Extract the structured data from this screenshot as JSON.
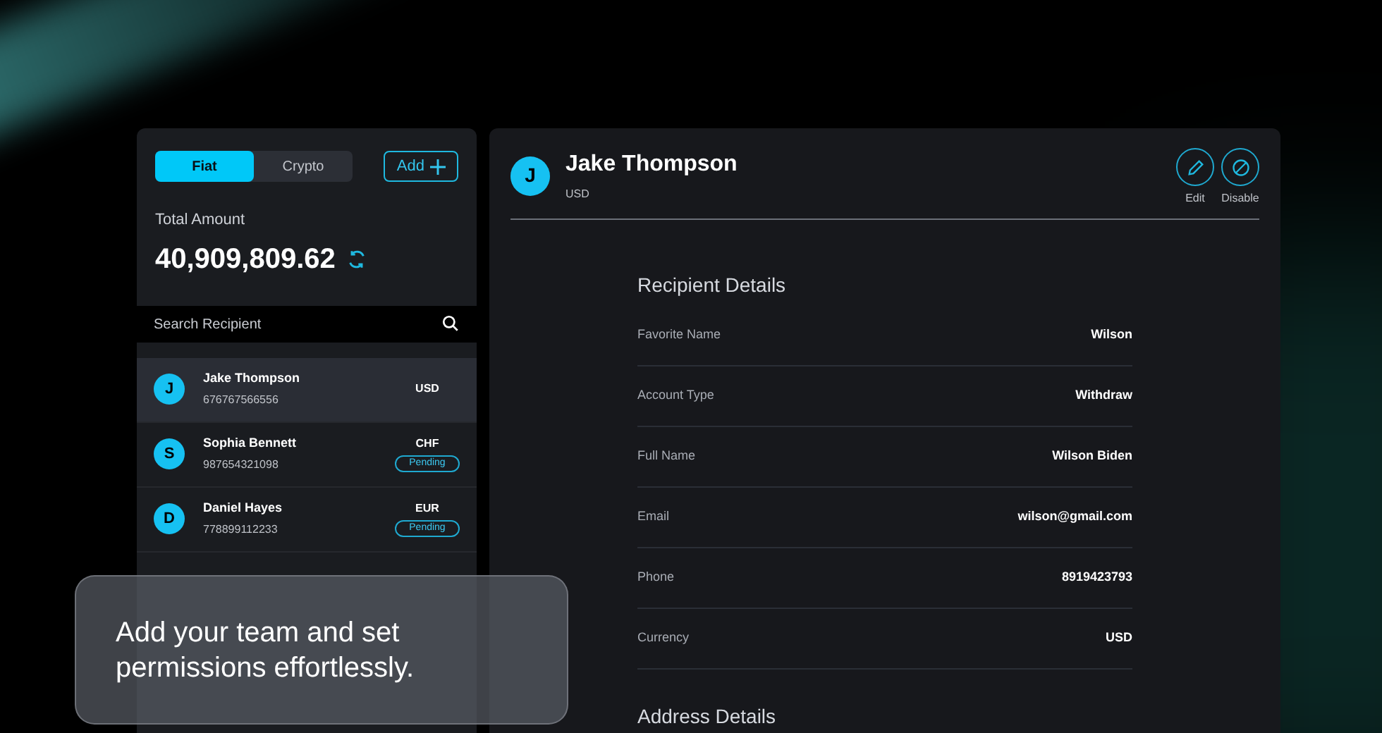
{
  "wallet": {
    "tabs": [
      {
        "label": "Fiat",
        "selected": true
      },
      {
        "label": "Crypto",
        "selected": false
      }
    ],
    "add_button": "Add",
    "total_label": "Total Amount",
    "total_value": "40,909,809.62",
    "search": {
      "placeholder": "Search Recipient"
    }
  },
  "recipients": [
    {
      "initial": "J",
      "name": "Jake Thompson",
      "account": "676767566556",
      "currency": "USD",
      "selected": true
    },
    {
      "initial": "S",
      "name": "Sophia Bennett",
      "account": "987654321098",
      "currency": "CHF",
      "status": "Pending",
      "selected": false
    },
    {
      "initial": "D",
      "name": "Daniel Hayes",
      "account": "778899112233",
      "currency": "EUR",
      "status": "Pending",
      "selected": false
    }
  ],
  "detail": {
    "initial": "J",
    "name": "Jake Thompson",
    "currency": "USD",
    "actions": [
      {
        "kind": "edit",
        "label": "Edit"
      },
      {
        "kind": "disable",
        "label": "Disable"
      }
    ],
    "section_title": "Recipient Details",
    "fields": [
      {
        "label": "Favorite Name",
        "value": "Wilson"
      },
      {
        "label": "Account Type",
        "value": "Withdraw"
      },
      {
        "label": "Full Name",
        "value": "Wilson Biden"
      },
      {
        "label": "Email",
        "value": "wilson@gmail.com"
      },
      {
        "label": "Phone",
        "value": "8919423793"
      },
      {
        "label": "Currency",
        "value": "USD"
      }
    ],
    "section_title_2": "Address Details"
  },
  "caption": "Add your team and set permissions effortlessly."
}
